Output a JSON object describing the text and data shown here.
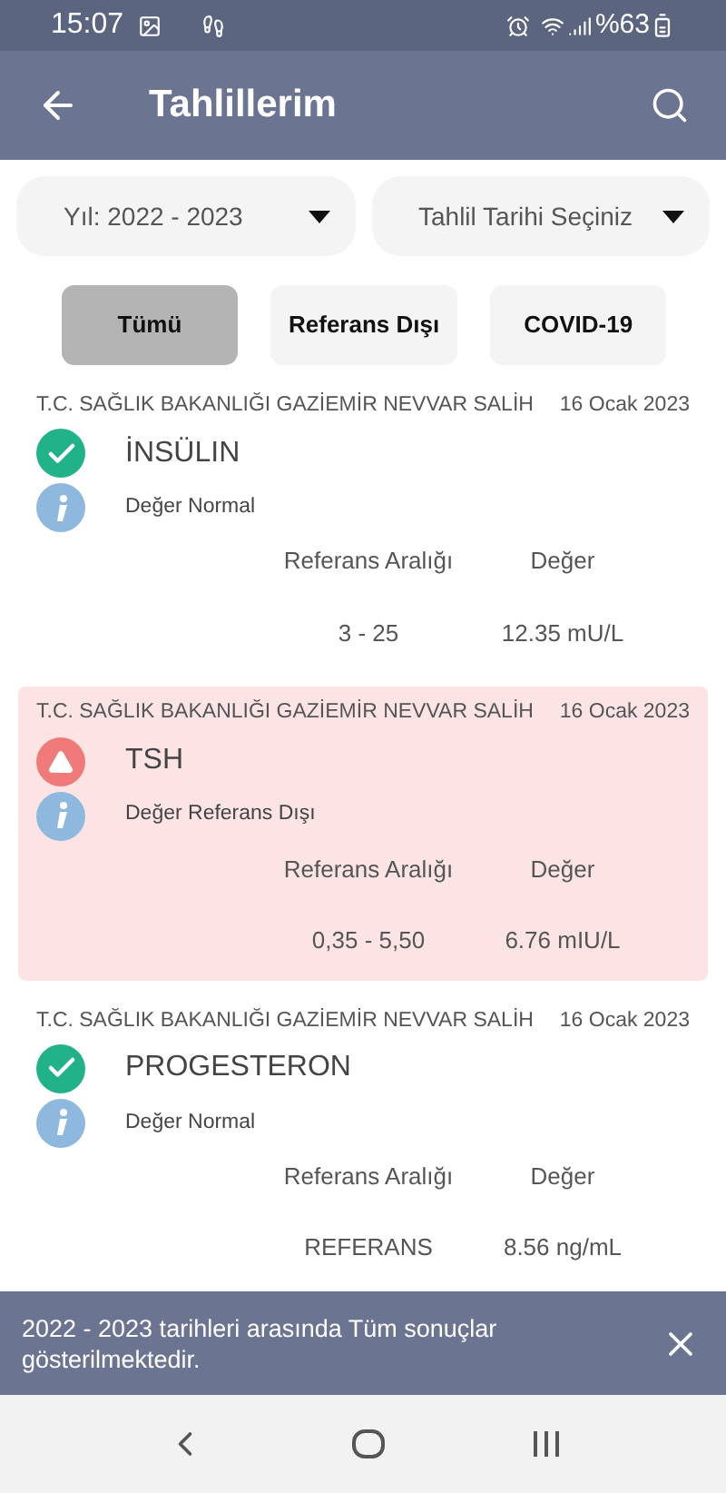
{
  "status_bar": {
    "time": "15:07",
    "battery": "%63"
  },
  "app_bar": {
    "title": "Tahlillerim"
  },
  "filters": [
    {
      "value": "Yıl: 2022 - 2023"
    },
    {
      "value": "Tahlil Tarihi Seçiniz"
    }
  ],
  "tabs": [
    {
      "label": "Tümü",
      "selected": true
    },
    {
      "label": "Referans Dışı",
      "selected": false
    },
    {
      "label": "COVID-19",
      "selected": false
    }
  ],
  "results": [
    {
      "institution": "T.C. SAĞLIK BAKANLIĞI GAZİEMİR NEVVAR SALİH",
      "date": "16 Ocak 2023",
      "test": "İNSÜLIN",
      "kind": "normal",
      "status": "Değer Normal",
      "range_label": "Referans Aralığı",
      "value_label": "Değer",
      "range": "3 - 25",
      "value": "12.35 mU/L"
    },
    {
      "institution": "T.C. SAĞLIK BAKANLIĞI GAZİEMİR NEVVAR SALİH",
      "date": "16 Ocak 2023",
      "test": "TSH",
      "kind": "abnormal",
      "status": "Değer Referans Dışı",
      "range_label": "Referans Aralığı",
      "value_label": "Değer",
      "range": "0,35 - 5,50",
      "value": "6.76 mIU/L"
    },
    {
      "institution": "T.C. SAĞLIK BAKANLIĞI GAZİEMİR NEVVAR SALİH",
      "date": "16 Ocak 2023",
      "test": "PROGESTERON",
      "kind": "normal",
      "status": "Değer Normal",
      "range_label": "Referans Aralığı",
      "value_label": "Değer",
      "range": "REFERANS",
      "value": "8.56 ng/mL"
    }
  ],
  "snackbar": {
    "message": "2022 - 2023 tarihleri arasında Tüm sonuçlar gösterilmektedir."
  }
}
